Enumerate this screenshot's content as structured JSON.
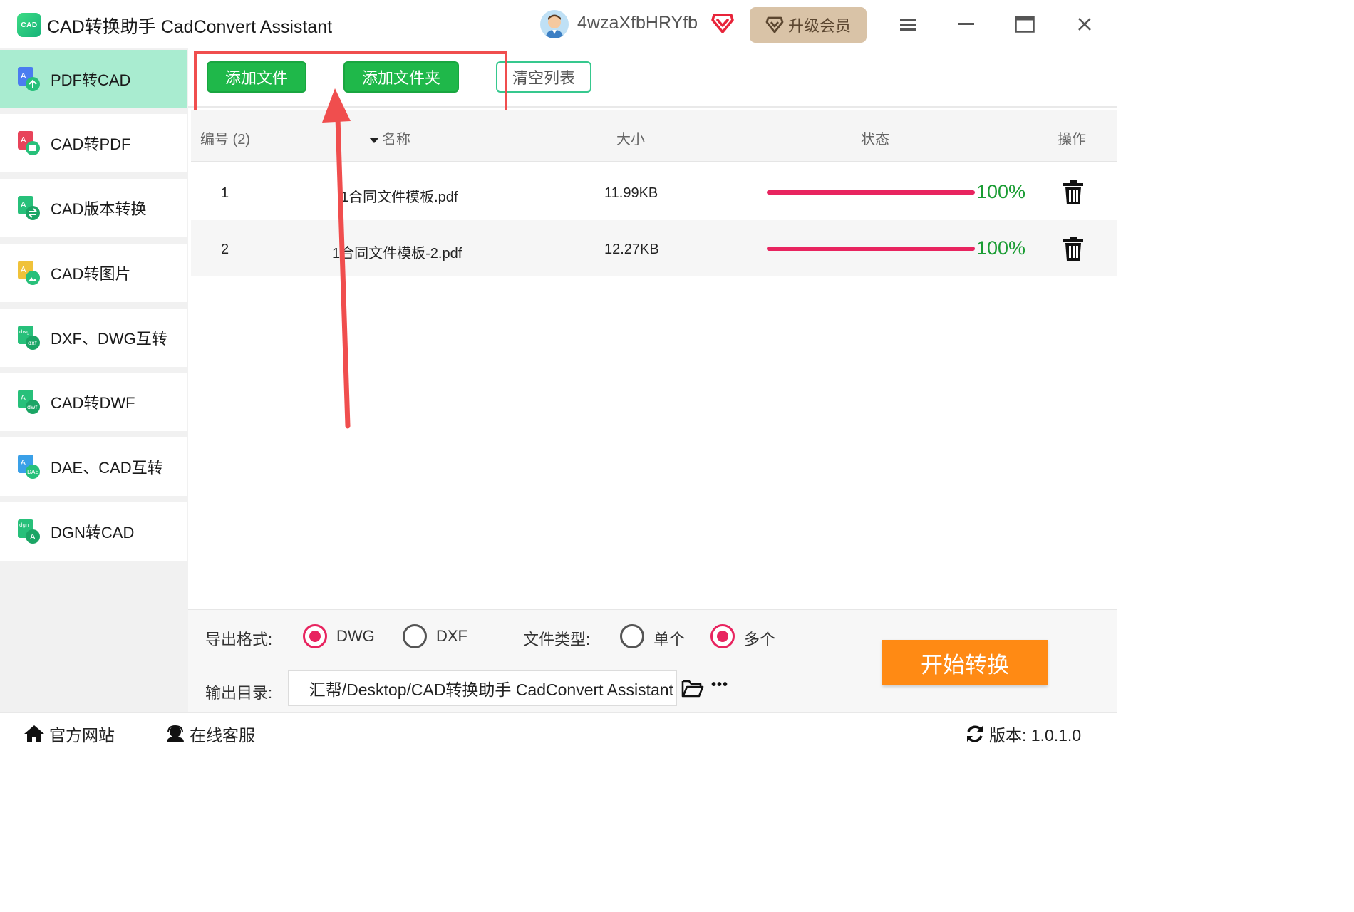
{
  "app": {
    "logo_text": "CAD",
    "title": "CAD转换助手 CadConvert Assistant",
    "username": "4wzaXfbHRYfb",
    "upgrade_label": "升级会员"
  },
  "sidebar": {
    "items": [
      {
        "label": "PDF转CAD",
        "icon": "pdf-to-cad-icon",
        "active": true
      },
      {
        "label": "CAD转PDF",
        "icon": "cad-to-pdf-icon"
      },
      {
        "label": "CAD版本转换",
        "icon": "cad-version-icon"
      },
      {
        "label": "CAD转图片",
        "icon": "cad-to-image-icon"
      },
      {
        "label": "DXF、DWG互转",
        "icon": "dxf-dwg-icon"
      },
      {
        "label": "CAD转DWF",
        "icon": "cad-to-dwf-icon"
      },
      {
        "label": "DAE、CAD互转",
        "icon": "dae-cad-icon"
      },
      {
        "label": "DGN转CAD",
        "icon": "dgn-to-cad-icon"
      }
    ]
  },
  "toolbar": {
    "add_file": "添加文件",
    "add_folder": "添加文件夹",
    "clear_list": "清空列表"
  },
  "table": {
    "headers": {
      "index": "编号 (2)",
      "name": "名称",
      "size": "大小",
      "status": "状态",
      "action": "操作"
    },
    "rows": [
      {
        "index": "1",
        "name": "1合同文件模板.pdf",
        "size": "11.99KB",
        "progress": 1.0,
        "percent": "100%"
      },
      {
        "index": "2",
        "name": "1合同文件模板-2.pdf",
        "size": "12.27KB",
        "progress": 1.0,
        "percent": "100%"
      }
    ]
  },
  "options": {
    "export_format_label": "导出格式:",
    "format_dwg": "DWG",
    "format_dxf": "DXF",
    "format_selected": "DWG",
    "file_type_label": "文件类型:",
    "type_single": "单个",
    "type_multiple": "多个",
    "type_selected": "多个",
    "output_dir_label": "输出目录:",
    "output_dir_value": "汇帮/Desktop/CAD转换助手 CadConvert Assistant",
    "more_label": "•••",
    "start_label": "开始转换"
  },
  "statusbar": {
    "website": "官方网站",
    "support": "在线客服",
    "version": "版本:  1.0.1.0"
  },
  "colors": {
    "accent_green": "#1fb84a",
    "active_nav": "#a9ecd0",
    "progress": "#e8245f",
    "percent_text": "#1a9c33",
    "start_button": "#ff8a14",
    "annotation": "#f04e4e"
  }
}
